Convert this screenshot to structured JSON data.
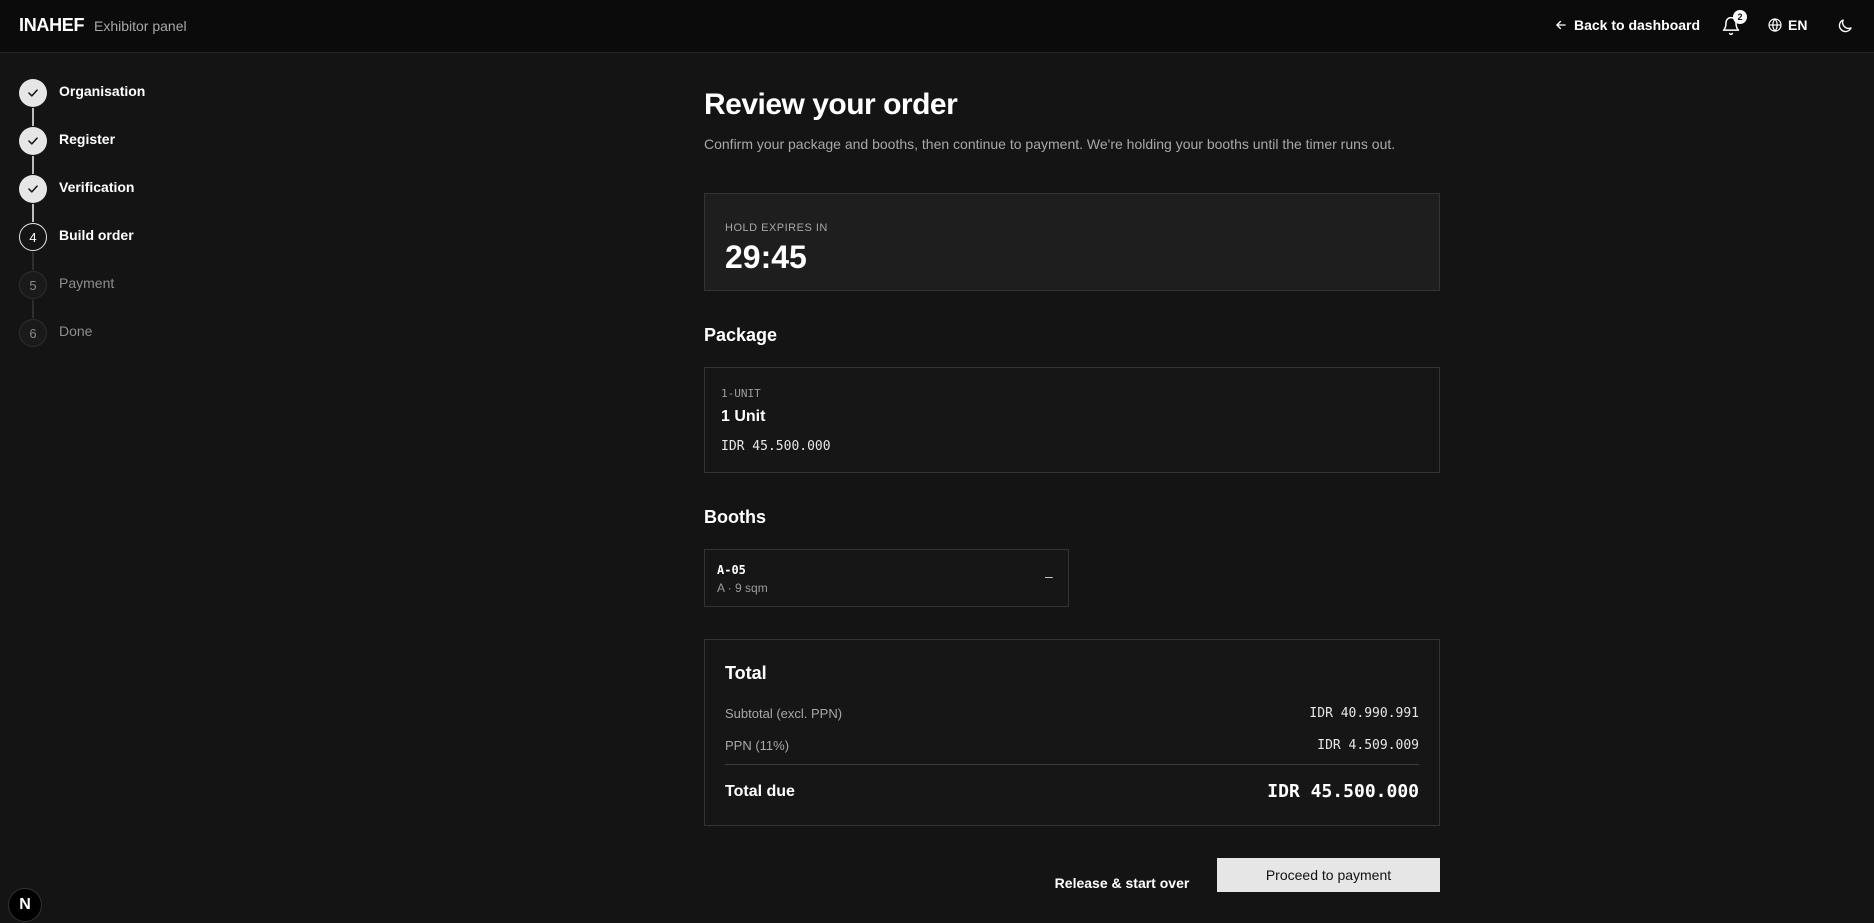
{
  "header": {
    "brand": "INAHEF",
    "subtitle": "Exhibitor panel",
    "back_label": "Back to dashboard",
    "notification_count": "2",
    "language": "EN"
  },
  "stepper": {
    "steps": [
      {
        "number": "1",
        "label": "Organisation",
        "state": "done"
      },
      {
        "number": "2",
        "label": "Register",
        "state": "done"
      },
      {
        "number": "3",
        "label": "Verification",
        "state": "done"
      },
      {
        "number": "4",
        "label": "Build order",
        "state": "current"
      },
      {
        "number": "5",
        "label": "Payment",
        "state": "todo"
      },
      {
        "number": "6",
        "label": "Done",
        "state": "todo"
      }
    ]
  },
  "main": {
    "title": "Review your order",
    "subtitle": "Confirm your package and booths, then continue to payment. We're holding your booths until the timer runs out.",
    "hold": {
      "label": "HOLD EXPIRES IN",
      "time": "29:45"
    },
    "package_section": "Package",
    "package": {
      "code": "1-UNIT",
      "name": "1 Unit",
      "price": "IDR 45.500.000"
    },
    "booths_section": "Booths",
    "booth": {
      "code": "A-05",
      "meta": "A · 9 sqm",
      "remove": "–"
    },
    "total": {
      "title": "Total",
      "subtotal_label": "Subtotal (excl. PPN)",
      "subtotal_value": "IDR 40.990.991",
      "ppn_label": "PPN (11%)",
      "ppn_value": "IDR 4.509.009",
      "due_label": "Total due",
      "due_value": "IDR 45.500.000"
    },
    "release_label": "Release & start over",
    "proceed_label": "Proceed to payment"
  },
  "dev_badge": "N"
}
